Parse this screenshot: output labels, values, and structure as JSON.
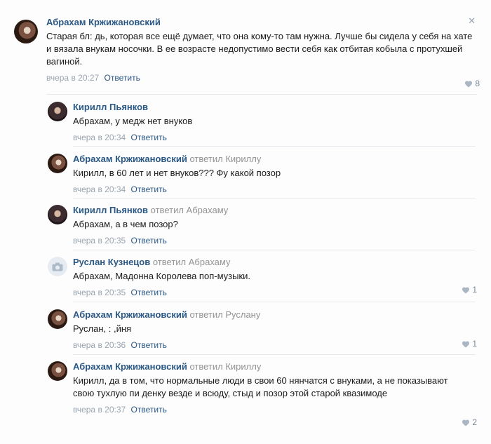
{
  "comments": [
    {
      "author": "Абрахам Кржижановский",
      "text": "Старая бл: дь, которая все ещё думает, что она кому-то там нужна. Лучше бы сидела у себя на хате и вязала внукам носочки. В ее возрасте недопустимо вести себя как отбитая кобыла с протухшей вагиной.",
      "time": "вчера в 20:27",
      "reply_label": "Ответить",
      "likes": "8",
      "close_glyph": "✕"
    }
  ],
  "replies": [
    {
      "author": "Кирилл Пьянков",
      "reply_prefix": "",
      "reply_to": "",
      "text": "Абрахам, у медж нет внуков",
      "time": "вчера в 20:34",
      "reply_label": "Ответить",
      "likes": ""
    },
    {
      "author": "Абрахам Кржижановский",
      "reply_prefix": "ответил",
      "reply_to": "Кириллу",
      "text": "Кирилл, в 60 лет и нет внуков??? Фу какой позор",
      "time": "вчера в 20:34",
      "reply_label": "Ответить",
      "likes": ""
    },
    {
      "author": "Кирилл Пьянков",
      "reply_prefix": "ответил",
      "reply_to": "Абрахаму",
      "text": "Абрахам, а в чем позор?",
      "time": "вчера в 20:35",
      "reply_label": "Ответить",
      "likes": ""
    },
    {
      "author": "Руслан Кузнецов",
      "reply_prefix": "ответил",
      "reply_to": "Абрахаму",
      "text": "Абрахам, Мадонна Королева поп-музыки.",
      "time": "вчера в 20:35",
      "reply_label": "Ответить",
      "likes": "1"
    },
    {
      "author": "Абрахам Кржижановский",
      "reply_prefix": "ответил",
      "reply_to": "Руслану",
      "text": "Руслан, : ,йня",
      "time": "вчера в 20:36",
      "reply_label": "Ответить",
      "likes": "1"
    },
    {
      "author": "Абрахам Кржижановский",
      "reply_prefix": "ответил",
      "reply_to": "Кириллу",
      "text": "Кирилл, да в том, что нормальные люди в свои 60 нянчатся с внуками, а не показывают свою тухлую пи денку везде и всюду, стыд и позор этой старой квазимоде",
      "time": "вчера в 20:37",
      "reply_label": "Ответить",
      "likes": "2"
    }
  ]
}
